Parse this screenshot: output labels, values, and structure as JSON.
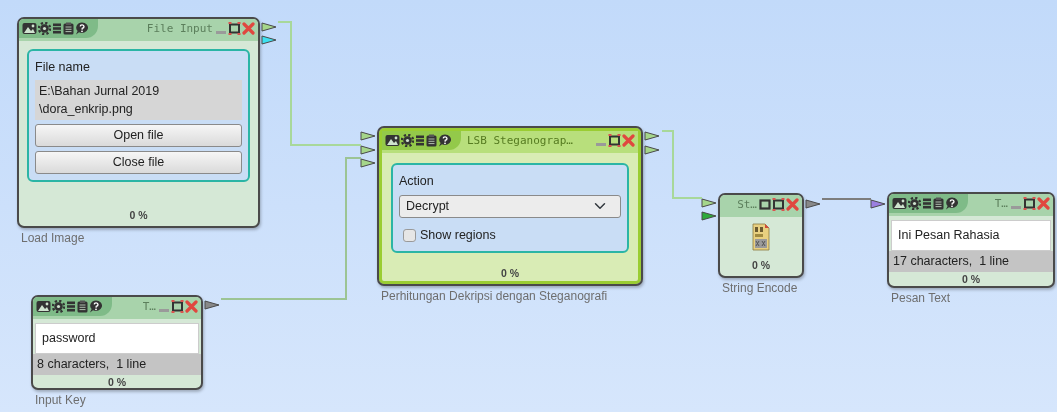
{
  "canvas": {
    "nodes": [
      {
        "kind": "file",
        "title": "File Input",
        "selected": false,
        "toolbar": true,
        "window_buttons": [
          {
            "kind": "minimize"
          },
          {
            "kind": "maximize"
          },
          {
            "kind": "close"
          }
        ],
        "panel": {
          "label": "File name",
          "value_lines": [
            "E:\\Bahan Jurnal 2019",
            "\\dora_enkrip.png"
          ],
          "buttons": [
            "Open file",
            "Close file"
          ]
        },
        "progress": "0 %",
        "caption": "Load Image",
        "ports": {
          "outputs": [
            {
              "color": "#a5d68a"
            },
            {
              "color": "#3ee0f0"
            }
          ]
        }
      },
      {
        "kind": "processor",
        "title": "LSB Steganograp…",
        "selected": true,
        "toolbar": true,
        "window_buttons": [
          {
            "kind": "minimize"
          },
          {
            "kind": "maximize"
          },
          {
            "kind": "close"
          }
        ],
        "panel": {
          "label": "Action",
          "value": "Decrypt",
          "checkbox": {
            "label": "Show regions",
            "checked": false
          }
        },
        "progress": "0 %",
        "caption": "Perhitungan Dekripsi dengan Steganografi",
        "ports": {
          "inputs": [
            {
              "color": "#a5d68a"
            },
            {
              "color": "#a5d68a"
            },
            {
              "color": "#a5d68a"
            }
          ],
          "outputs": [
            {
              "color": "#a5d68a"
            },
            {
              "color": "#a5d68a"
            }
          ]
        }
      },
      {
        "kind": "encoder",
        "title": "St…",
        "selected": false,
        "toolbar": false,
        "window_buttons": [
          {
            "kind": "restore"
          },
          {
            "kind": "maximize"
          },
          {
            "kind": "close"
          }
        ],
        "progress": "0 %",
        "caption": "String Encode",
        "ports": {
          "inputs": [
            {
              "color": "#a5d68a"
            },
            {
              "color": "#2eaa3a"
            }
          ],
          "outputs": [
            {
              "color": "#888888"
            }
          ]
        }
      },
      {
        "kind": "text",
        "title": "T…",
        "selected": false,
        "toolbar": true,
        "window_buttons": [
          {
            "kind": "minimize"
          },
          {
            "kind": "maximize"
          },
          {
            "kind": "close"
          }
        ],
        "text": "Ini Pesan Rahasia",
        "status": "17 characters,  1 line",
        "progress": "0 %",
        "caption": "Pesan Text",
        "ports": {
          "inputs": [
            {
              "color": "#9b7fe0"
            }
          ]
        }
      },
      {
        "kind": "text",
        "title": "T…",
        "selected": false,
        "toolbar": true,
        "window_buttons": [
          {
            "kind": "minimize"
          },
          {
            "kind": "maximize"
          },
          {
            "kind": "close"
          }
        ],
        "text": "password",
        "status": "8 characters,  1 line",
        "progress": "0 %",
        "caption": "Input Key",
        "ports": {
          "outputs": [
            {
              "color": "#888888"
            }
          ]
        }
      }
    ]
  }
}
